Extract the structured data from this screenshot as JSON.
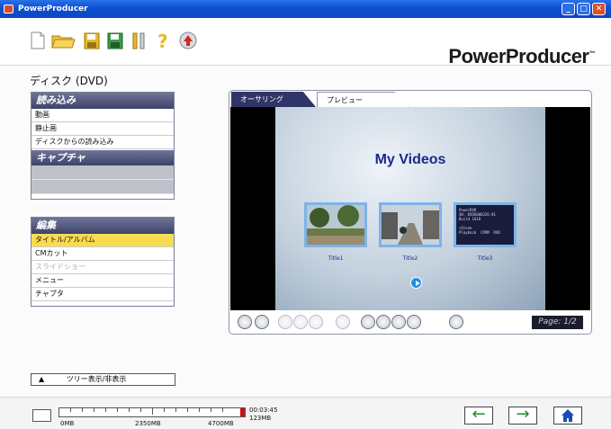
{
  "window": {
    "title": "PowerProducer",
    "brand": "PowerProducer",
    "brand_mark": "™"
  },
  "toolbar": {
    "icons": [
      "new-file-icon",
      "open-folder-icon",
      "save-icon",
      "save-as-icon",
      "tools-icon",
      "help-icon",
      "update-icon"
    ]
  },
  "disc_label": "ディスク (DVD)",
  "import_panel": {
    "header": "読み込み",
    "items": [
      "動画",
      "静止画",
      "ディスクからの読み込み"
    ]
  },
  "capture_panel": {
    "header": "キャプチャ"
  },
  "edit_panel": {
    "header": "編集",
    "items": [
      {
        "label": "タイトル/アルバム",
        "state": "selected"
      },
      {
        "label": "CMカット",
        "state": "normal"
      },
      {
        "label": "スライドショー",
        "state": "disabled"
      },
      {
        "label": "メニュー",
        "state": "normal"
      },
      {
        "label": "チャプタ",
        "state": "normal"
      }
    ]
  },
  "tree_toggle": {
    "arrow": "▲",
    "label": "ツリー表示/非表示"
  },
  "preview": {
    "tabs": [
      "オーサリング",
      "プレビュー"
    ],
    "menu_title": "My Videos",
    "titles": [
      "Title1",
      "Title2",
      "Title3"
    ],
    "thumb3_text": "PowerDVD\nSN: DVD6000326-01\nBuild 1618\n\n+Stone\nPlayback  CPRM  DVD",
    "page_indicator": "Page: 1/2"
  },
  "capacity": {
    "labels": [
      "0MB",
      "2350MB",
      "4700MB"
    ],
    "duration": "00:03:45",
    "size": "123MB",
    "used_fraction": 0.026
  },
  "nav": {
    "back": "←",
    "forward": "→"
  },
  "colors": {
    "titlebar": "#0b4fd1",
    "panel_header": "#3e436b",
    "selected": "#f7dc52",
    "menu_title": "#1a2a8c",
    "bar_used": "#cc1111"
  }
}
